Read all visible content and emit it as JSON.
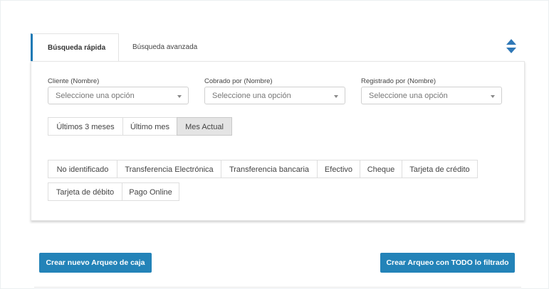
{
  "tabs": {
    "quick": "Búsqueda rápida",
    "advanced": "Búsqueda avanzada"
  },
  "filters": {
    "client": {
      "label": "Cliente (Nombre)",
      "placeholder": "Seleccione una opción"
    },
    "charged_by": {
      "label": "Cobrado por (Nombre)",
      "placeholder": "Seleccione una opción"
    },
    "registered_by": {
      "label": "Registrado por (Nombre)",
      "placeholder": "Seleccione una opción"
    }
  },
  "periods": {
    "items": [
      "Últimos 3 meses",
      "Último mes",
      "Mes Actual"
    ],
    "selected": "Mes Actual"
  },
  "payment_methods": [
    "No identificado",
    "Transferencia Electrónica",
    "Transferencia bancaria",
    "Efectivo",
    "Cheque",
    "Tarjeta de crédito",
    "Tarjeta de débito",
    "Pago Online"
  ],
  "actions": {
    "new_cash_count": "Crear nuevo Arqueo de caja",
    "cash_count_all_filtered": "Crear Arqueo con TODO lo filtrado"
  },
  "colors": {
    "primary": "#2383b8",
    "tab_accent": "#1f7ab5",
    "selected_segment": "#e4e4e4"
  },
  "icons": {
    "panel_toggle": "sort-up-down-icon",
    "select_caret": "caret-down-icon"
  }
}
